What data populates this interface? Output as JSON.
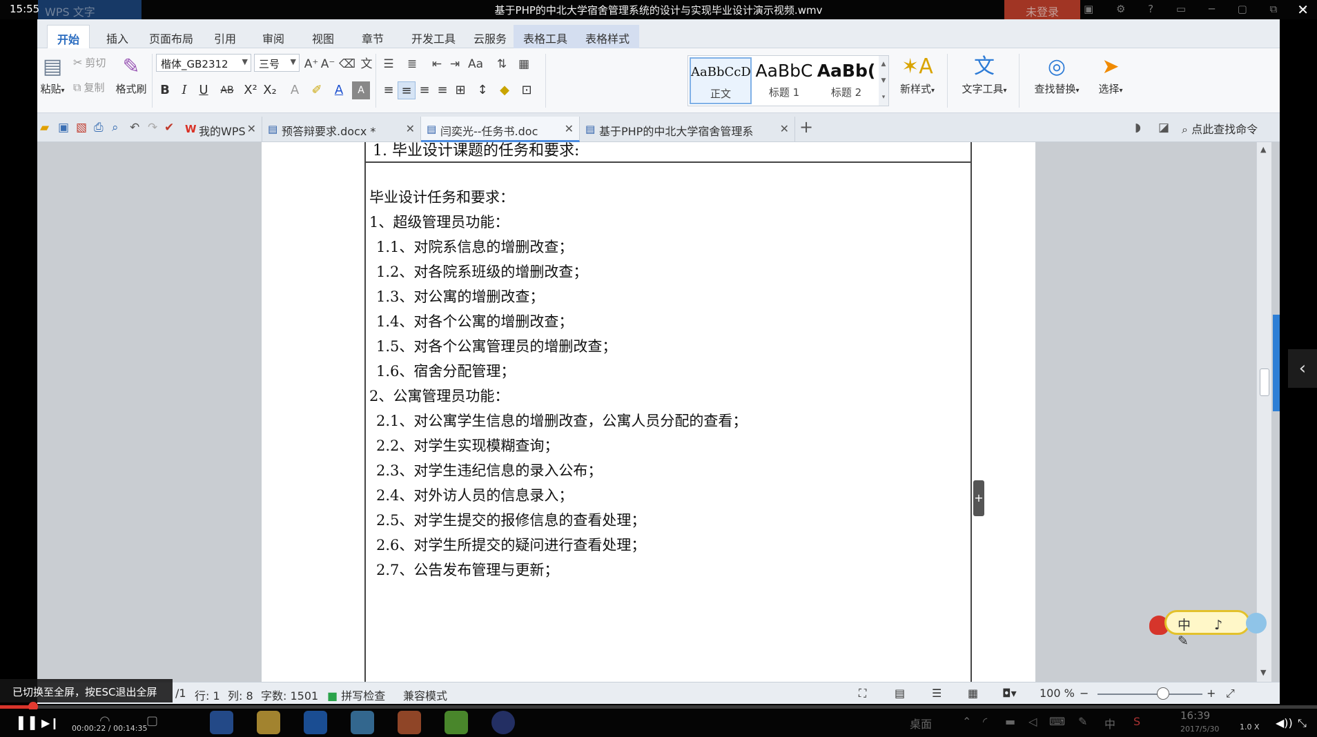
{
  "player": {
    "clock": "15:55",
    "video_title": "基于PHP的中北大学宿舍管理系统的设计与实现毕业设计演示视频.wmv",
    "wps_label": "WPS 文字",
    "login_label": "未登录",
    "close_label": "✕",
    "time": "00:00:22 / 00:14:35",
    "speed": "1.0 X",
    "toast": "已切换至全屏，按ESC退出全屏",
    "progress_fraction": 0.025
  },
  "menu": {
    "tabs": [
      {
        "label": "开始"
      },
      {
        "label": "插入"
      },
      {
        "label": "页面布局"
      },
      {
        "label": "引用"
      },
      {
        "label": "审阅"
      },
      {
        "label": "视图"
      },
      {
        "label": "章节"
      },
      {
        "label": "开发工具"
      },
      {
        "label": "云服务"
      },
      {
        "label": "表格工具"
      },
      {
        "label": "表格样式"
      }
    ]
  },
  "ribbon": {
    "paste": "粘贴",
    "cut": "剪切",
    "copy": "复制",
    "format_painter": "格式刷",
    "font_name": "楷体_GB2312",
    "font_size": "三号",
    "styles": [
      {
        "preview": "AaBbCcD",
        "name": "正文"
      },
      {
        "preview": "AaBbC",
        "name": "标题 1"
      },
      {
        "preview": "AaBb(",
        "name": "标题 2"
      }
    ],
    "new_style": "新样式",
    "text_tools": "文字工具",
    "find_replace": "查找替换",
    "select": "选择"
  },
  "docbar": {
    "tabs": [
      {
        "label": "我的WPS"
      },
      {
        "label": "预答辩要求.docx *"
      },
      {
        "label": "闫奕光--任务书.doc"
      },
      {
        "label": "基于PHP的中北大学宿舍管理系统.doc"
      }
    ],
    "search_command": "点此查找命令"
  },
  "document": {
    "section_title": "1. 毕业设计课题的任务和要求:",
    "lines": [
      "毕业设计任务和要求：",
      "1、超级管理员功能：",
      "  1.1、对院系信息的增删改查；",
      "  1.2、对各院系班级的增删改查；",
      "  1.3、对公寓的增删改查；",
      "  1.4、对各个公寓的增删改查；",
      "  1.5、对各个公寓管理员的增删改查；",
      "  1.6、宿舍分配管理；",
      "2、公寓管理员功能：",
      "  2.1、对公寓学生信息的增删改查，公寓人员分配的查看；",
      "  2.2、对学生实现模糊查询；",
      "  2.3、对学生违纪信息的录入公布；",
      "  2.4、对外访人员的信息录入；",
      "  2.5、对学生提交的报修信息的查看处理；",
      "  2.6、对学生所提交的疑问进行查看处理；",
      "  2.7、公告发布管理与更新；"
    ]
  },
  "status": {
    "page": "/1",
    "row": "行: 1",
    "col": "列: 8",
    "wordcount": "字数: 1501",
    "spellcheck": "拼写检查",
    "compat": "兼容模式",
    "zoom": "100 %"
  },
  "taskbar": {
    "desktop": "桌面",
    "ime": "中",
    "clock": "16:39",
    "date": "2017/5/30"
  },
  "ime_widget": {
    "label": "中 ♪ ✎"
  },
  "colors": {
    "accent": "#2a6cc0",
    "progress": "#d9342b"
  }
}
